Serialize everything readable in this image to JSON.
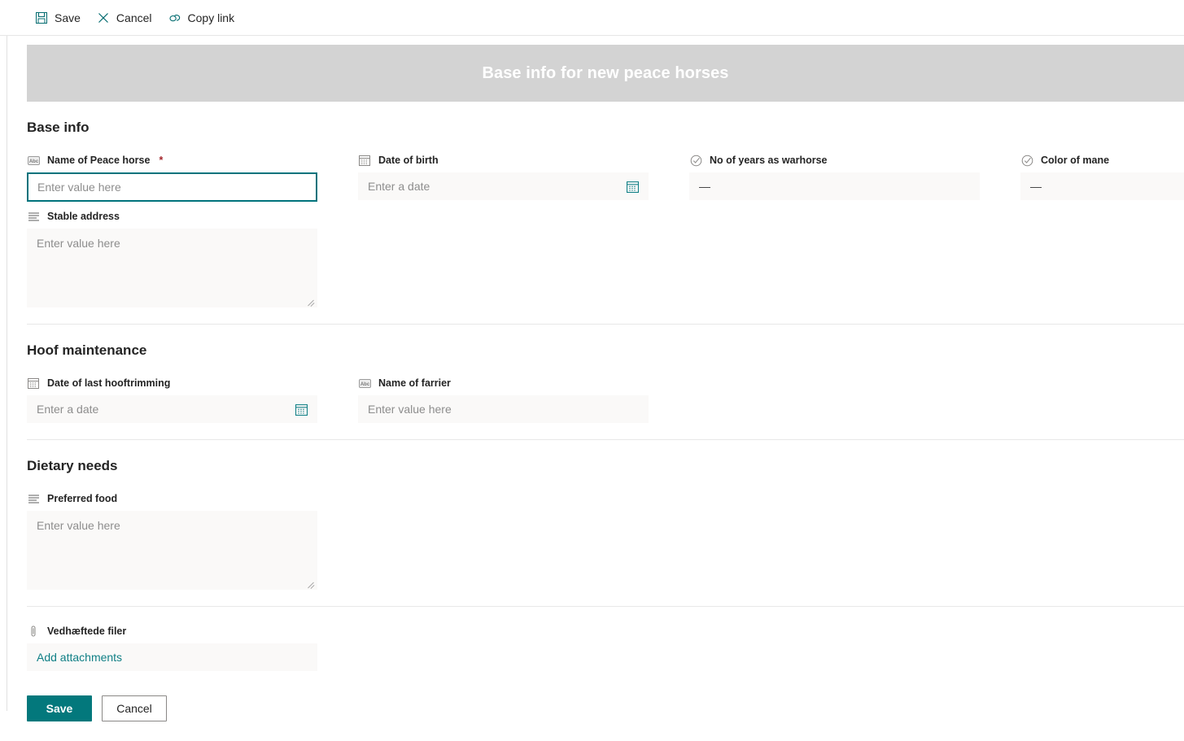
{
  "commandbar": {
    "save": "Save",
    "cancel": "Cancel",
    "copy_link": "Copy link"
  },
  "banner": {
    "title": "Base info for new peace horses",
    "background": "#d3d3d3",
    "text_color": "#ffffff"
  },
  "theme": {
    "accent": "#03787c",
    "focus_border": "#00737c",
    "link": "#0f7f85",
    "required_marker": "#a4262c",
    "field_background": "#faf9f8"
  },
  "sections": [
    {
      "title": "Base info",
      "fields": [
        {
          "label": "Name of Peace horse",
          "required": true,
          "required_marker": "*",
          "icon": "abc-icon",
          "type": "text",
          "value": "",
          "placeholder": "Enter value here",
          "focused": true
        },
        {
          "label": "Date of birth",
          "required": false,
          "icon": "calendar-icon",
          "type": "date",
          "value": "",
          "placeholder": "Enter a date"
        },
        {
          "label": "No of years as warhorse",
          "required": false,
          "icon": "choice-icon",
          "type": "choice",
          "value": "—"
        },
        {
          "label": "Color of mane",
          "required": false,
          "icon": "choice-icon",
          "type": "choice",
          "value": "—"
        },
        {
          "label": "Stable address",
          "required": false,
          "icon": "multiline-icon",
          "type": "textarea",
          "value": "",
          "placeholder": "Enter value here"
        }
      ]
    },
    {
      "title": "Hoof maintenance",
      "fields": [
        {
          "label": "Date of last hooftrimming",
          "required": false,
          "icon": "calendar-icon",
          "type": "date",
          "value": "",
          "placeholder": "Enter a date"
        },
        {
          "label": "Name of farrier",
          "required": false,
          "icon": "abc-icon",
          "type": "text",
          "value": "",
          "placeholder": "Enter value here"
        }
      ]
    },
    {
      "title": "Dietary needs",
      "fields": [
        {
          "label": "Preferred food",
          "required": false,
          "icon": "multiline-icon",
          "type": "textarea",
          "value": "",
          "placeholder": "Enter value here"
        }
      ]
    }
  ],
  "attachments": {
    "label": "Vedhæftede filer",
    "icon": "paperclip-icon",
    "add_label": "Add attachments"
  },
  "footer": {
    "save": "Save",
    "cancel": "Cancel"
  }
}
